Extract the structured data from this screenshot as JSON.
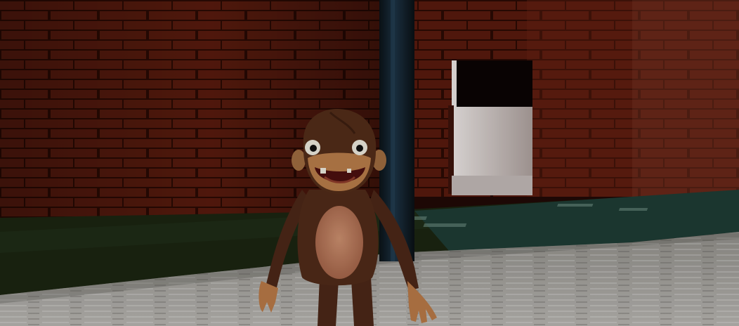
{
  "scene": {
    "colors": {
      "brick": "#5a1a0f",
      "brick_dark": "#2e0c06",
      "mortar": "#1f0804",
      "grass": "#1c2412",
      "floor_light": "#a8a6a2",
      "floor_dark": "#6f6d69",
      "teal_carpet": "#1d3a33",
      "pole": "#0f1a22",
      "doorway_inner": "#d9d4d2",
      "doorway_top": "#0a0404",
      "monkey_fur": "#4e2a18",
      "monkey_face": "#c7905f",
      "monkey_belly": "#c08062"
    },
    "icons": {
      "character": "monkey-character-icon"
    }
  }
}
